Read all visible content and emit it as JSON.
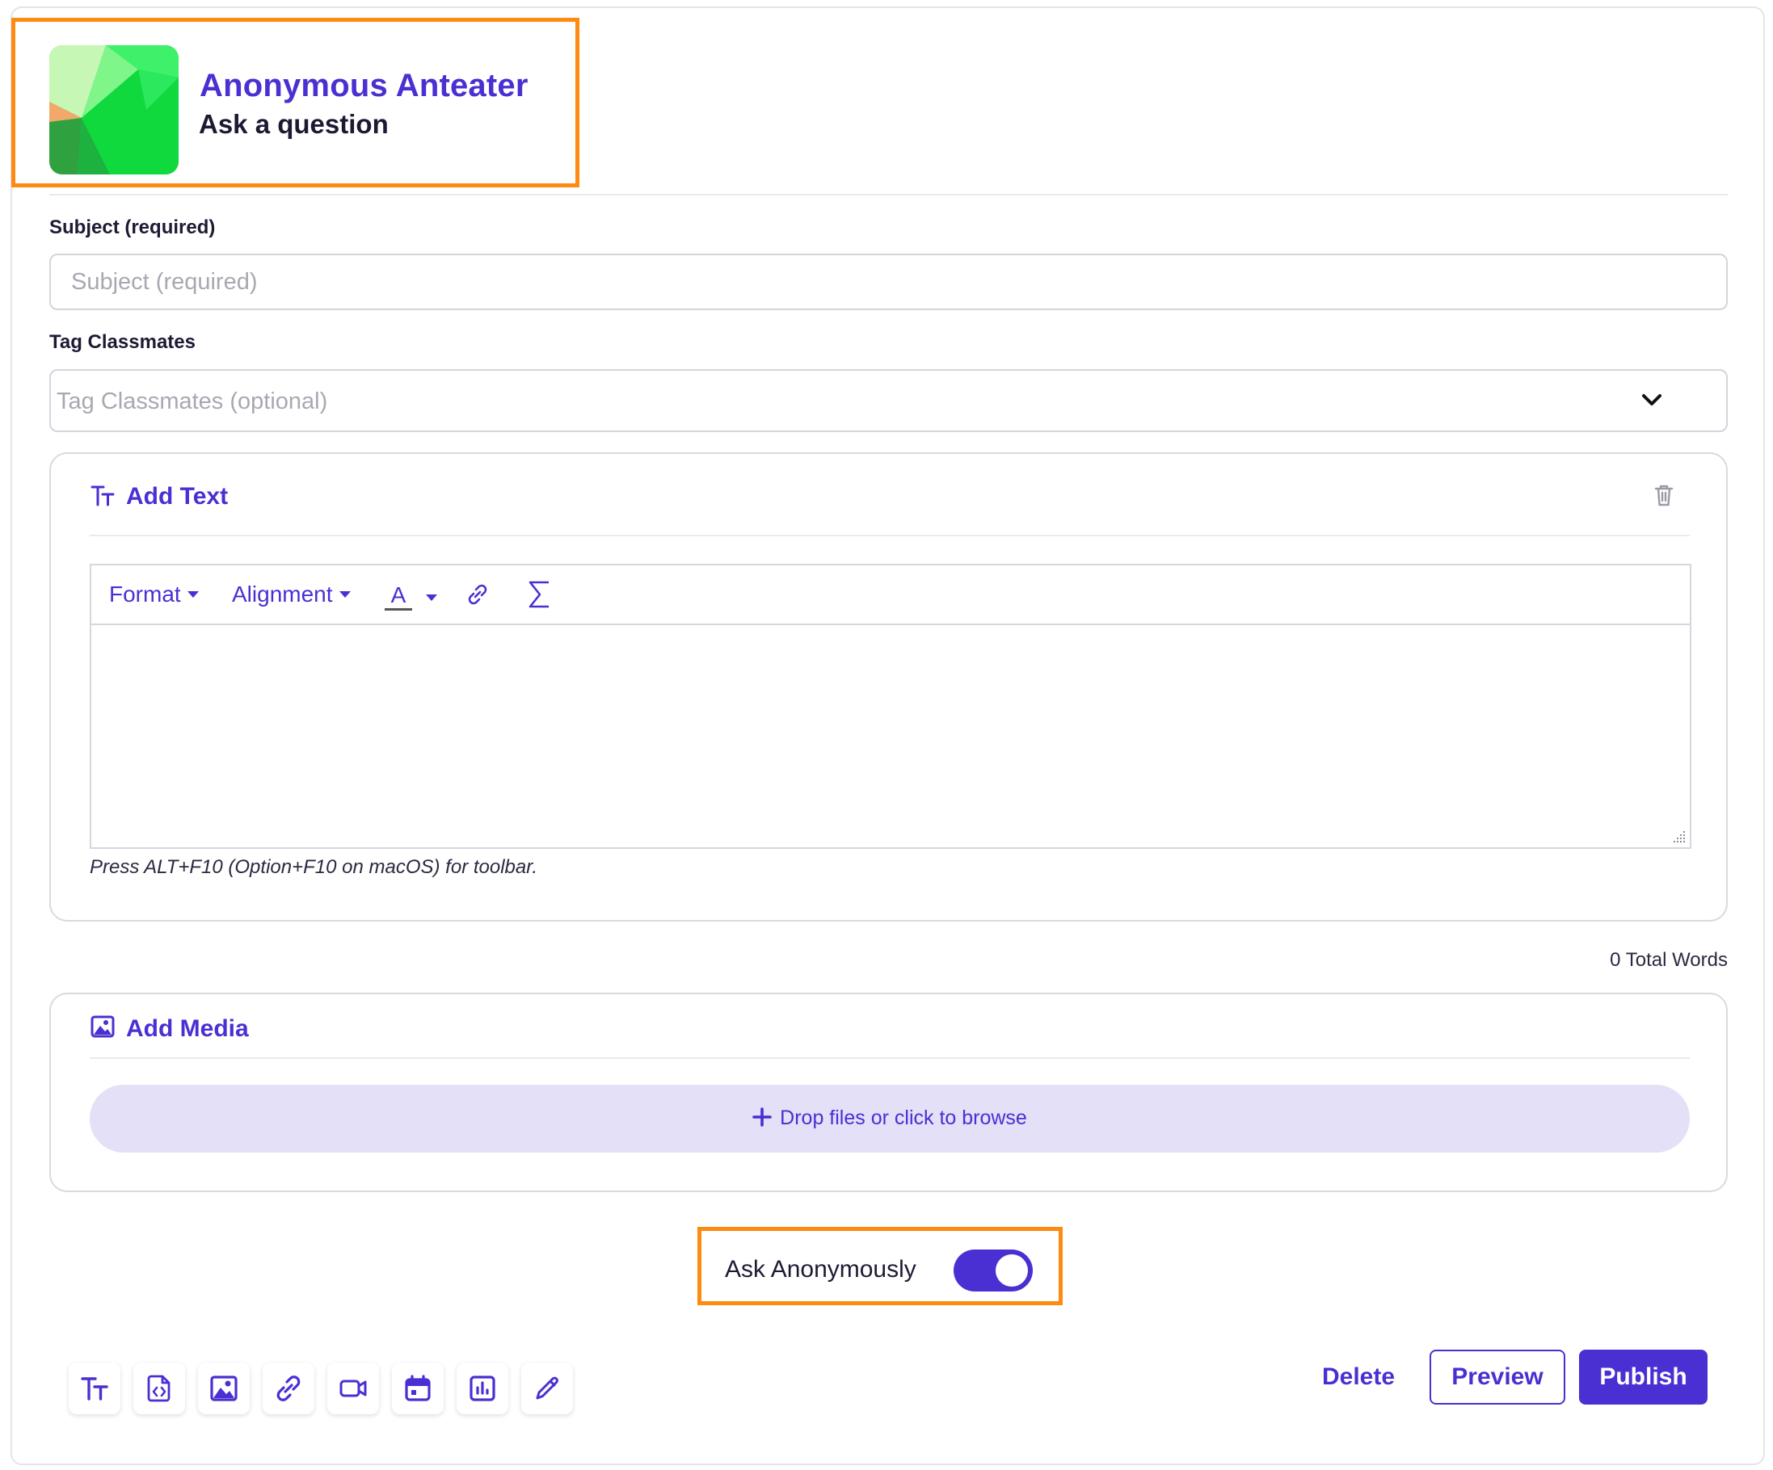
{
  "header": {
    "user_name": "Anonymous Anteater",
    "subtitle": "Ask a question",
    "avatar_icon": "green-polygon-avatar"
  },
  "subject": {
    "label": "Subject (required)",
    "placeholder": "Subject (required)",
    "value": ""
  },
  "tag_classmates": {
    "label": "Tag Classmates",
    "placeholder": "Tag Classmates (optional)",
    "dropdown_icon": "chevron-down-icon"
  },
  "text_block": {
    "title": "Add Text",
    "icon": "text-format-icon",
    "delete_icon": "trash-icon",
    "toolbar": {
      "format": "Format",
      "alignment": "Alignment",
      "text_color_glyph": "A",
      "link_icon": "link-icon",
      "math_icon": "sigma-icon"
    },
    "hint": "Press ALT+F10 (Option+F10 on macOS) for toolbar."
  },
  "word_count": "0 Total Words",
  "media_block": {
    "title": "Add Media",
    "icon": "image-icon",
    "dropzone": "Drop files or click to browse"
  },
  "anonymous": {
    "label": "Ask Anonymously",
    "enabled": true
  },
  "tools": [
    "text-format-icon",
    "embed-code-icon",
    "image-icon",
    "link-icon",
    "video-icon",
    "calendar-icon",
    "chart-icon",
    "pencil-icon"
  ],
  "actions": {
    "delete": "Delete",
    "preview": "Preview",
    "publish": "Publish"
  },
  "colors": {
    "accent": "#4a2fd2",
    "highlight": "#ff8a10",
    "dropzone_bg": "#e3e0f7"
  }
}
